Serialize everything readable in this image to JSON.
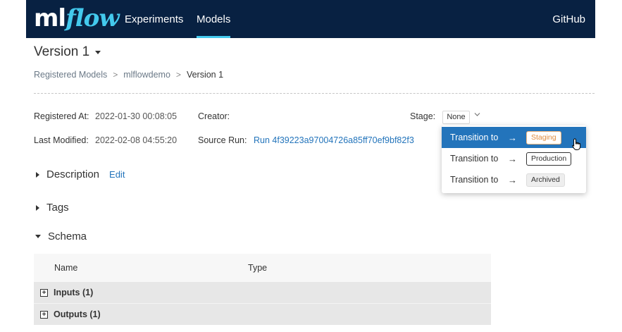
{
  "nav": {
    "logo_ml": "ml",
    "logo_flow": "flow",
    "experiments": "Experiments",
    "models": "Models",
    "github": "GitHub"
  },
  "page": {
    "title": "Version 1"
  },
  "breadcrumb": {
    "registered_models": "Registered Models",
    "model": "mlflowdemo",
    "version": "Version 1",
    "separator": ">"
  },
  "meta": {
    "registered_at_label": "Registered At:",
    "registered_at_value": "2022-01-30 00:08:05",
    "creator_label": "Creator:",
    "creator_value": "",
    "stage_label": "Stage:",
    "stage_value": "None",
    "last_modified_label": "Last Modified:",
    "last_modified_value": "2022-02-08 04:55:20",
    "source_run_label": "Source Run:",
    "source_run_value": "Run 4f39223a97004726a85ff70ef9bf82f3"
  },
  "stage_dropdown": {
    "items": [
      {
        "text": "Transition to",
        "arrow": "→",
        "tag": "Staging"
      },
      {
        "text": "Transition to",
        "arrow": "→",
        "tag": "Production"
      },
      {
        "text": "Transition to",
        "arrow": "→",
        "tag": "Archived"
      }
    ]
  },
  "sections": {
    "description": "Description",
    "edit": "Edit",
    "tags": "Tags",
    "schema": "Schema"
  },
  "schema_table": {
    "columns": [
      "Name",
      "Type"
    ],
    "rows": [
      "Inputs (1)",
      "Outputs (1)"
    ]
  },
  "colors": {
    "navbar": "#082142",
    "accent": "#43c9ed",
    "link": "#2374bb",
    "staging": "#e08a3c"
  },
  "icons": {
    "stage_chevron": "chevron-down-icon",
    "expand": "plus-square-icon",
    "cursor": "hand-cursor-icon"
  }
}
